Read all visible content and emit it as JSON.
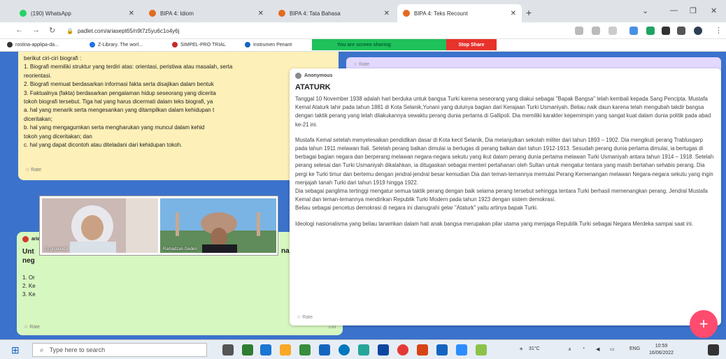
{
  "browser": {
    "tabs": [
      {
        "label": "(190) WhatsApp",
        "color": "#25d366"
      },
      {
        "label": "BIPA 4: Idiom",
        "color": "#e36b1f"
      },
      {
        "label": "BIPA 4: Tata Bahasa",
        "color": "#e36b1f"
      },
      {
        "label": "BIPA 4: Teks Recount",
        "color": "#e36b1f"
      }
    ],
    "new_tab": "+",
    "url": "padlet.com/ariasept65/n9t7z5yu6c1o4y6j",
    "bookmarks": [
      {
        "label": "rostina-applipa-da...",
        "color": "#333"
      },
      {
        "label": "Z-Library. The worl...",
        "color": "#1a73e8"
      },
      {
        "label": "SIMPEL-PRO TRIAL",
        "color": "#c62828"
      },
      {
        "label": "Instrumen Penant",
        "color": "#1565c0"
      }
    ],
    "sharing": {
      "text": "You are screen sharing",
      "stop": "Stop Share"
    }
  },
  "yellow_card": {
    "lines": [
      "berikut ciri-ciri biografi :",
      "1. Biografi memiliki struktur yang terdiri atas: orientasi, peristiwa atau masalah, serta",
      "reorientasi.",
      "2. Biografi memuat berdasarkan informasi fakta serta disajikan dalam bentuk",
      "3. Faktualnya (fakta) berdasarkan pengalaman hidup seseorang yang dicerita",
      "tokoh biografi tersebut. Tiga hal yang harus dicermati dalam teks biografi, ya",
      "a. hal yang menarik serta mengesankan yang ditampilkan dalam kehidupan t",
      "diceritakan;",
      "b. hal yang mengagumkan serta mengharukan yang muncul dalam kehid",
      "tokoh yang diceritakan; dan",
      "c. hal yang dapat dicontoh atau diteladani dari kehidupan tokoh."
    ],
    "rate": "Rate"
  },
  "purple_card": {
    "rate": "Rate"
  },
  "green_card": {
    "author": "ariasept65",
    "title_1": "Unt",
    "title_2": "neg",
    "title_suffix": "na",
    "items": [
      "1. Or",
      "2. Ke",
      "3. Ke"
    ],
    "rate": "Rate",
    "comments": "0"
  },
  "video_call": {
    "participant_1": "zy pujiawida",
    "participant_2": "Ramadzan Geden"
  },
  "white_card": {
    "author": "Anonymous",
    "title": "ATATURK",
    "p1": "Tanggal 10 November 1938 adalah hari berduka untuk bangsa Turki karena seseorang yang diakui sebagai \"Bapak Bangsa\" telah kembali kepada Sang Pencipta. Mustafa Kemal Ataturk lahir pada tahun 1881 di Kota Selanik,Yunani yang dulunya bagian dari Kerajaan Turki Usmaniyah. Beliau naik daun karena telah mengubah takdir bangsa dengan taktik perang yang telah dilakukannya sewaktu perang dunia pertama di Gallipoli. Dia memiliki karakter kepemimpin yang sangat kuat dalam dunia politik pada abad ke-21 ini.",
    "p2": "Mustafa Kemal setelah menyelesaikan pendidikan dasar di Kota kecil Selanik, Dia melanjutkan sekolah militer dari tahun 1893 – 1902. Dia mengikuti perang Trablusgarp pada tahun 1911 melawan Itali. Setelah perang balkan dimulai ia bertugas di perang balkan dari tahun 1912-1913. Sesudah perang dunia pertama dimulai, ia bertugas di berbagai bagian negara dan berperang melawan negara-negara sekutu yang ikut dalam perang dunia pertama melawan Turki Usmaniyah antara tahun 1914 – 1918. Setelah perang selesai dan Turki Usmaniyah dikalahkan, ia ditugaskan sebagai menteri pertahanan oleh Sultan untuk mengatur tentara yang masih bertahan sehabis perang. Dia pergi ke Turki timur dan bertemu dengan jendral-jendral besar kemudian Dia dan teman-temannya memulai Perang Kemenangan melawan Negara-negara sekutu yang ingin menjajah tanah Turki dari tahun 1919 hingga 1922.",
    "p3": "Dia sebagai panglima tertinggi mengatur semua taktik perang dengan baik selama perang tersebut sehingga tentara Turki berhasil memenangkan perang. Jendral Mustafa Kemal dan teman-temannya mendirikan Republik Turki Modern pada tahun 1923 dengan sistem demokrasi.",
    "p4": "Beliau sebagai pencetus demokrasi di negara ini dianugrahi gelar \"Ataturk\" yaitu artinya bapak Turki.",
    "p5": "Ideologi nasionalisma yang beliau tanamkan dalam hati anak bangsa merupakan pilar utama yang menjaga Republik Turki sebagai Negara Merdeka sampai saat ini.",
    "rate": "Rate"
  },
  "fab": "+",
  "taskbar": {
    "search_placeholder": "Type here to search",
    "weather": "31°C",
    "lang": "ENG",
    "time": "10:59",
    "date": "16/06/2022"
  }
}
